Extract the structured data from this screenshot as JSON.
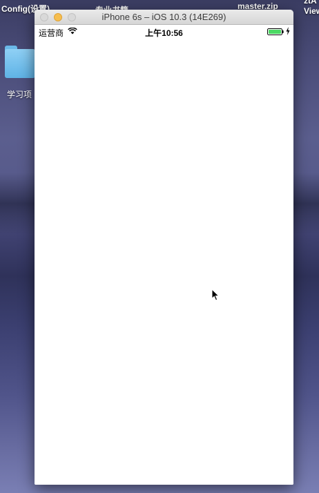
{
  "desktop": {
    "labels": {
      "config": "Config(设置)",
      "book": "专业书籍",
      "master_zip": "master.zip",
      "right_top": "ztA",
      "right_second": "View",
      "folder": "学习项"
    }
  },
  "window": {
    "title": "iPhone 6s – iOS 10.3 (14E269)"
  },
  "ios": {
    "statusbar": {
      "carrier": "运营商",
      "time": "上午10:56",
      "battery_color": "#4cd964"
    }
  },
  "icons": {
    "wifi": "wifi-icon",
    "battery": "battery-icon",
    "charging": "charging-bolt-icon",
    "cursor": "mouse-cursor-icon",
    "folder": "folder-icon"
  }
}
